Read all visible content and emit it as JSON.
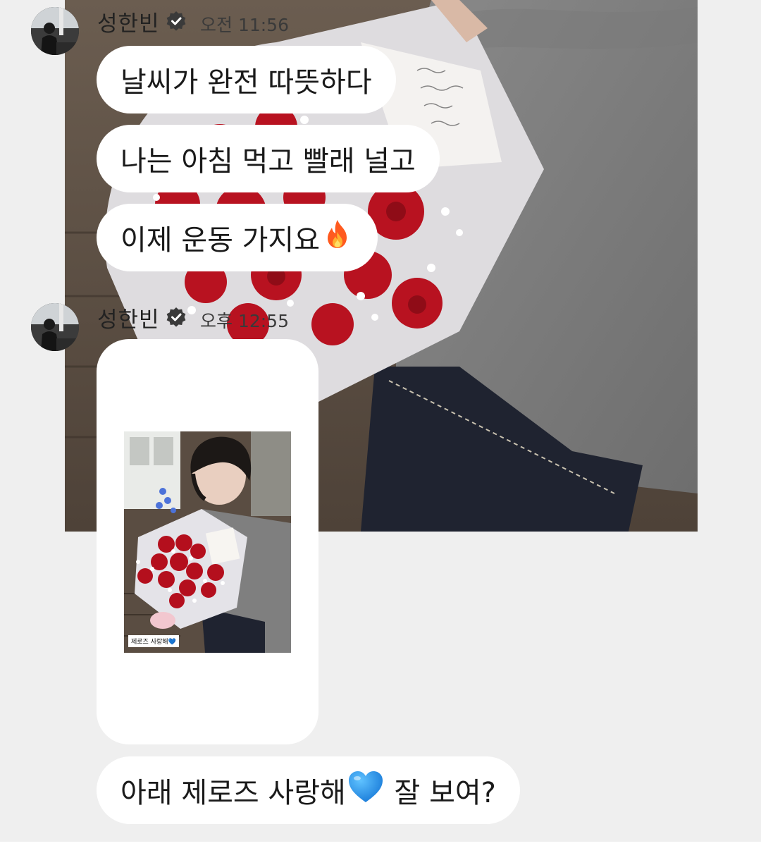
{
  "messages_block_1": {
    "sender_name": "성한빈",
    "time": "오전 11:56",
    "bubbles": [
      {
        "text": "날씨가 완전 따뜻하다"
      },
      {
        "text": "나는 아침 먹고 빨래 널고"
      },
      {
        "text": "이제 운동 가지요",
        "emoji": "🔥"
      }
    ]
  },
  "messages_block_2": {
    "sender_name": "성한빈",
    "time": "오후 12:55",
    "image_caption": "제로즈 사랑해",
    "image_caption_emoji": "💙",
    "last_bubble": {
      "text_before": "아래 제로즈 사랑해",
      "emoji": "💙",
      "text_after": " 잘 보여?"
    }
  },
  "icons": {
    "verified": "verified-badge-icon",
    "fire": "fire-emoji-icon",
    "blue_heart": "blue-heart-emoji-icon"
  },
  "colors": {
    "background": "#efefef",
    "bubble": "#ffffff",
    "text": "#1a1a1a",
    "verified": "#3a3a3a",
    "blue_heart": "#1e88e5",
    "fire": "#ff5a1f"
  }
}
